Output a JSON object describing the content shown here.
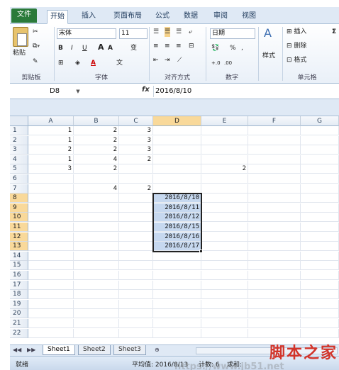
{
  "ribbon_tabs": [
    "文件",
    "开始",
    "插入",
    "页面布局",
    "公式",
    "数据",
    "审阅",
    "视图"
  ],
  "clipboard": {
    "paste": "粘贴",
    "group": "剪贴板"
  },
  "font": {
    "name": "宋体",
    "size": "11",
    "bold": "B",
    "italic": "I",
    "underline": "U",
    "grow": "A",
    "shrink": "A",
    "wen": "变",
    "group": "字体"
  },
  "alignment": {
    "group": "对齐方式"
  },
  "number": {
    "format": "日期",
    "percent": "%",
    "comma": ",",
    "group": "数字"
  },
  "styles": {
    "label": "样式"
  },
  "cells": {
    "insert": "插入",
    "delete": "删除",
    "format": "格式",
    "group": "单元格"
  },
  "formula_bar": {
    "name_box": "D8",
    "fx": "fx",
    "content": "2016/8/10"
  },
  "columns": [
    "A",
    "B",
    "C",
    "D",
    "E",
    "F",
    "G"
  ],
  "rows": [
    "1",
    "2",
    "3",
    "4",
    "5",
    "6",
    "7",
    "8",
    "9",
    "10",
    "11",
    "12",
    "13",
    "14",
    "15",
    "16",
    "17",
    "18",
    "19",
    "20",
    "21",
    "22"
  ],
  "cells_data": {
    "A1": "1",
    "B1": "2",
    "C1": "3",
    "A2": "1",
    "B2": "2",
    "C2": "3",
    "A3": "2",
    "B3": "2",
    "C3": "3",
    "A4": "1",
    "B4": "4",
    "C4": "2",
    "A5": "3",
    "B5": "2",
    "E5": "2",
    "B7": "4",
    "C7": "2",
    "D8": "2016/8/10",
    "D9": "2016/8/11",
    "D10": "2016/8/12",
    "D11": "2016/8/15",
    "D12": "2016/8/16",
    "D13": "2016/8/17"
  },
  "sheets": [
    "Sheet1",
    "Sheet2",
    "Sheet3"
  ],
  "status": {
    "ready": "就绪",
    "average": "平均值: 2016/8/13",
    "count": "计数: 6",
    "sum": "求和: "
  },
  "watermark": {
    "cn": "脚本之家",
    "url": "https://www.jb51.net"
  }
}
